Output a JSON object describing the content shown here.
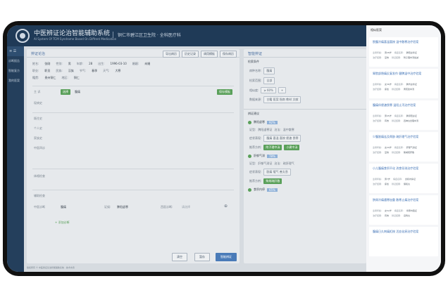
{
  "header": {
    "title": "中医辨证论治智能辅助系统",
    "subtitle": "AI System Of TCM Syndrome Based On Diffrent Medication",
    "hospital": "铜仁市碧江区卫生院 · 全科医疗科"
  },
  "sidebar": {
    "head": "≡  ☰",
    "items": [
      "诊断报告",
      "智能复方",
      "我的医案"
    ]
  },
  "main": {
    "title": "辨证论治",
    "toolbar": [
      "导出病历",
      "历史记录",
      "调用模板",
      "保存病历"
    ],
    "patient": {
      "name_label": "姓名:",
      "name": "张刚",
      "sex_label": "性别:",
      "sex": "男",
      "age_label": "年龄:",
      "age": "28",
      "birth_label": "出生:",
      "birth": "1996-03-10",
      "blood_label": "婚姻:",
      "blood": "未婚",
      "job_label": "职业:",
      "job": "职员",
      "ethnic_label": "民族:",
      "ethnic": "汉族",
      "season_label": "节气:",
      "season": "春季",
      "weather_label": "天气:",
      "weather": "大寒",
      "nation_label": "籍贯:",
      "nation": "贵州铜仁",
      "region_label": "地区:",
      "region": "铜仁"
    },
    "chief_label": "主 诉",
    "chief_tag": "选择",
    "chief_value": "腹痛",
    "save_tpl": "保存模板",
    "fields": [
      "现病史",
      "既往史",
      "个人史",
      "家族史",
      "中医四诊",
      "体格检查",
      "辅助检查",
      "中医诊断"
    ],
    "diagnosis": "腹痛",
    "syndrome_label": "证候:",
    "syndrome": "脾阳虚寒",
    "west_label": "西医诊断:",
    "west": "请选择",
    "add_diag": "+ 添加诊断",
    "actions": [
      "清空",
      "暂存",
      "智能辨证"
    ]
  },
  "right": {
    "title": "智能辨证",
    "cond_title": "检索条件",
    "conds": [
      {
        "label": "病种名称:",
        "value": "腹痛"
      },
      {
        "label": "检索范围:",
        "value": "全部"
      },
      {
        "label": "相似度:",
        "value": "≥ 60%"
      },
      {
        "label": "数据来源:",
        "value": "古籍  医案  指南  教材  文献"
      }
    ],
    "result_title": "辨证建议",
    "results": [
      {
        "name": "脾阳虚寒",
        "pct": "92%",
        "syn_label": "证型:",
        "syn": "脾阳虚寒证",
        "treat_label": "治法:",
        "treat": "温中散寒",
        "sx_label": "症状表现:",
        "sx": "腹痛 喜温 喜按 便溏 畏寒",
        "rx_label": "推荐方剂:",
        "rx1": "附子理中汤",
        "rx2": "小建中汤"
      },
      {
        "name": "肝郁气滞",
        "pct": "78%",
        "syn_label": "证型:",
        "syn": "肝郁气滞证",
        "treat_label": "治法:",
        "treat": "疏肝理气",
        "sx_label": "症状表现:",
        "sx": "胀痛 嗳气 善太息",
        "rx_label": "推荐方剂:",
        "rx1": "柴胡疏肝散",
        "rx2": ""
      },
      {
        "name": "食积内停",
        "pct": "65%",
        "syn_label": "",
        "syn": "",
        "treat_label": "",
        "treat": "",
        "sx_label": "",
        "sx": "",
        "rx_label": "",
        "rx1": "",
        "rx2": ""
      }
    ]
  },
  "overlay": {
    "title": "相似医案",
    "cards": [
      {
        "title": "脘腹冷痛喜温喜按 温中散寒治疗验案",
        "k1": "患者年龄:",
        "v1": "男28岁",
        "k2": "病症名称:",
        "v2": "脾阳虚寒证",
        "k3": "治疗结果:",
        "v3": "显效",
        "k4": "辨证结果:",
        "v4": "附子理中汤加减"
      },
      {
        "title": "胃脘部隐痛反复发作 健脾温中治疗验案",
        "k1": "患者年龄:",
        "v1": "女36岁",
        "k2": "病症名称:",
        "v2": "脾胃虚寒证",
        "k3": "治疗结果:",
        "v3": "痊愈",
        "k4": "辨证结果:",
        "v4": "黄芪建中汤"
      },
      {
        "title": "腹痛伴便溏畏寒 温阳止泻治疗验案",
        "k1": "患者年龄:",
        "v1": "男45岁",
        "k2": "病症名称:",
        "v2": "脾肾阳虚证",
        "k3": "治疗结果:",
        "v3": "有效",
        "k4": "辨证结果:",
        "v4": "四神丸合理中汤"
      },
      {
        "title": "少腹胀痛连及两胁 疏肝理气治疗验案",
        "k1": "患者年龄:",
        "v1": "女29岁",
        "k2": "病症名称:",
        "v2": "肝郁气滞证",
        "k3": "治疗结果:",
        "v3": "显效",
        "k4": "辨证结果:",
        "v4": "柴胡疏肝散"
      },
      {
        "title": "小儿腹痛食积不化 消食导滞治疗验案",
        "k1": "患者年龄:",
        "v1": "男7岁",
        "k2": "病症名称:",
        "v2": "食积内停证",
        "k3": "治疗结果:",
        "v3": "痊愈",
        "k4": "辨证结果:",
        "v4": "保和丸"
      },
      {
        "title": "脐周冷痛遇寒加重 散寒止痛治疗验案",
        "k1": "患者年龄:",
        "v1": "女52岁",
        "k2": "病症名称:",
        "v2": "寒邪内阻证",
        "k3": "治疗结果:",
        "v3": "有效",
        "k4": "辨证结果:",
        "v4": "良附丸"
      },
      {
        "title": "腹痛日久刺痛拒按 活血化瘀治疗验案",
        "k1": "",
        "v1": "",
        "k2": "",
        "v2": "",
        "k3": "",
        "v3": "",
        "k4": "",
        "v4": ""
      }
    ]
  },
  "footer": "版权所有 © 中医辨证论治智能辅助系统 · 技术支持"
}
